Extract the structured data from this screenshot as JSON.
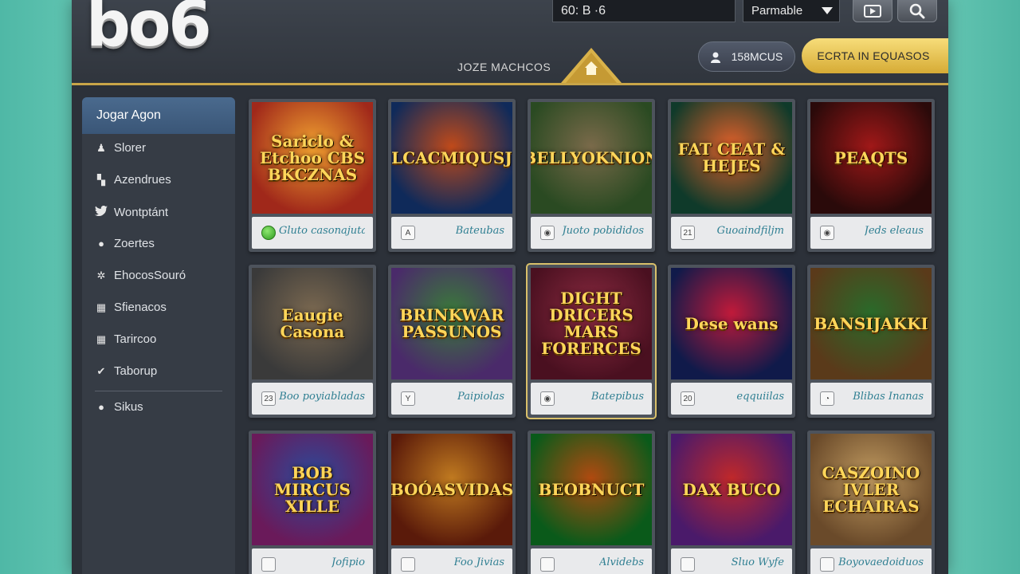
{
  "header": {
    "logo": "bo6",
    "search_value": "60: B ·6",
    "select_value": "Parmable",
    "nav_center": "JOZE MACHCOS",
    "user_label": "158MCUS",
    "cta_label": "ECRTA IN EQUASOS"
  },
  "sidebar": {
    "active": "Jogar Agon",
    "items": [
      {
        "icon": "person-icon",
        "glyph": "♟",
        "label": "Slorer"
      },
      {
        "icon": "book-icon",
        "glyph": "▚",
        "label": "Azendrues"
      },
      {
        "icon": "twitter-icon",
        "glyph": "🐦",
        "label": "Wontptánt"
      },
      {
        "icon": "drop-icon",
        "glyph": "●",
        "label": "Zoertes"
      },
      {
        "icon": "star-icon",
        "glyph": "✲",
        "label": "EhocosSouró"
      },
      {
        "icon": "grid-icon",
        "glyph": "▦",
        "label": "Sfienacos"
      },
      {
        "icon": "table-icon",
        "glyph": "▦",
        "label": "Tarircoo"
      },
      {
        "icon": "check-icon",
        "glyph": "✔",
        "label": "Taborup"
      }
    ],
    "footer_item": {
      "icon": "circle-icon",
      "glyph": "●",
      "label": "Sikus"
    }
  },
  "games": [
    {
      "title": "Sariclo & Etchoo CBS BKCZNAS",
      "footer_icon": "",
      "footer_label": "Gluto casonajutaid",
      "colors": [
        "#a0281a",
        "#f0a030"
      ]
    },
    {
      "title": "LCACMIQUSJ",
      "footer_icon": "A",
      "footer_label": "Bateubas",
      "colors": [
        "#0f2a5a",
        "#c04a1a"
      ]
    },
    {
      "title": "BELLYOKNION",
      "footer_icon": "◉",
      "footer_label": "Juoto pobididos",
      "colors": [
        "#2a4a22",
        "#7a6a4a"
      ]
    },
    {
      "title": "FAT CEAT & HEJES",
      "footer_icon": "21",
      "footer_label": "Guoaindfiljm",
      "colors": [
        "#0f3a2a",
        "#e0602a"
      ]
    },
    {
      "title": "PEAQTS",
      "footer_icon": "◉",
      "footer_label": "Jeds eleaus",
      "colors": [
        "#2a0a0a",
        "#a01818"
      ]
    },
    {
      "title": "Eaugie Casona",
      "footer_icon": "23",
      "footer_label": "Boo poyiabladas",
      "colors": [
        "#3a3a3a",
        "#7a6850"
      ]
    },
    {
      "title": "BRINKWAR PASSUNOS",
      "footer_icon": "Y",
      "footer_label": "Paipiolas",
      "colors": [
        "#4a2a6a",
        "#3a7a3a"
      ]
    },
    {
      "title": "DIGHT DRICERS MARS FORERCES",
      "footer_icon": "◉",
      "footer_label": "Batepibus",
      "colors": [
        "#4a1020",
        "#8a2a40"
      ]
    },
    {
      "title": "Dese wans",
      "footer_icon": "20",
      "footer_label": "eqquiilas",
      "colors": [
        "#101a4a",
        "#c01a3a"
      ]
    },
    {
      "title": "BANSIJAKKI",
      "footer_icon": "◔",
      "footer_label": "Blibas Inanas",
      "colors": [
        "#5a3a1a",
        "#2a6a2a"
      ]
    },
    {
      "title": "BOB MIRCUS XILLE",
      "footer_icon": "",
      "footer_label": "Jofipio",
      "colors": [
        "#6a1a5a",
        "#2a4a9a"
      ]
    },
    {
      "title": "BOÓASVIDAS",
      "footer_icon": "",
      "footer_label": "Foo Jivias",
      "colors": [
        "#5a1a0a",
        "#c07a20"
      ]
    },
    {
      "title": "BEOBNUCT",
      "footer_icon": "",
      "footer_label": "Alvidebs",
      "colors": [
        "#0a5a1a",
        "#b04a10"
      ]
    },
    {
      "title": "DAX BUCO",
      "footer_icon": "",
      "footer_label": "Sluo Wyfe",
      "colors": [
        "#4a1a6a",
        "#c0282a"
      ]
    },
    {
      "title": "CASZOINO IVLER ECHAIRAS",
      "footer_icon": "",
      "footer_label": "Boyovaedoiduos",
      "colors": [
        "#6a4a2a",
        "#c09a60"
      ]
    }
  ]
}
